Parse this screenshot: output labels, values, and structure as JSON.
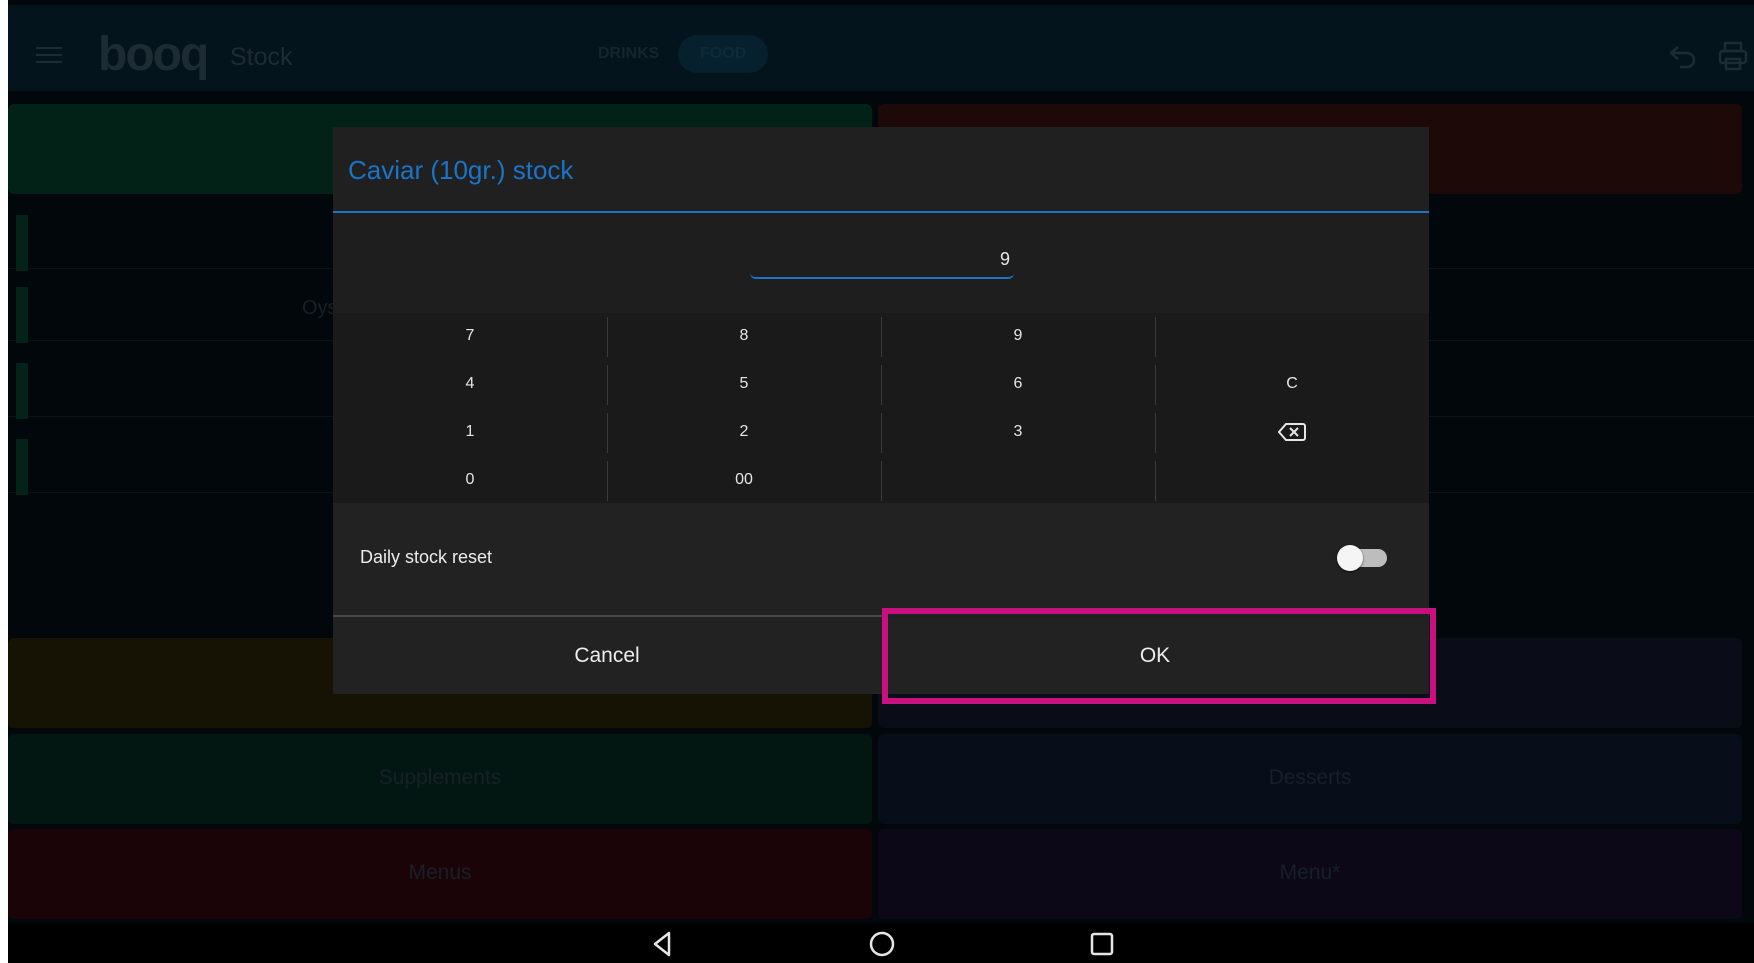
{
  "appbar": {
    "logo": "booq",
    "title": "Stock",
    "tabs": [
      {
        "label": "DRINKS"
      },
      {
        "label": "FOOD"
      }
    ]
  },
  "background": {
    "partial_label": "Oys",
    "tiles": [
      {
        "label": "Supplements"
      },
      {
        "label": "Desserts"
      },
      {
        "label": "Menus"
      },
      {
        "label": "Menu*"
      }
    ]
  },
  "dialog": {
    "title": "Caviar (10gr.) stock",
    "value": "9",
    "keypad": {
      "rows": [
        [
          "7",
          "8",
          "9",
          ""
        ],
        [
          "4",
          "5",
          "6",
          "C"
        ],
        [
          "1",
          "2",
          "3",
          "backspace"
        ],
        [
          "0",
          "00",
          "",
          ""
        ]
      ]
    },
    "daily_reset_label": "Daily stock reset",
    "daily_reset_on": false,
    "cancel_label": "Cancel",
    "ok_label": "OK"
  },
  "colors": {
    "accent": "#1a74c8",
    "highlight": "#c8117f"
  },
  "navbar": {
    "icons": [
      "back-icon",
      "home-icon",
      "recents-icon"
    ]
  }
}
